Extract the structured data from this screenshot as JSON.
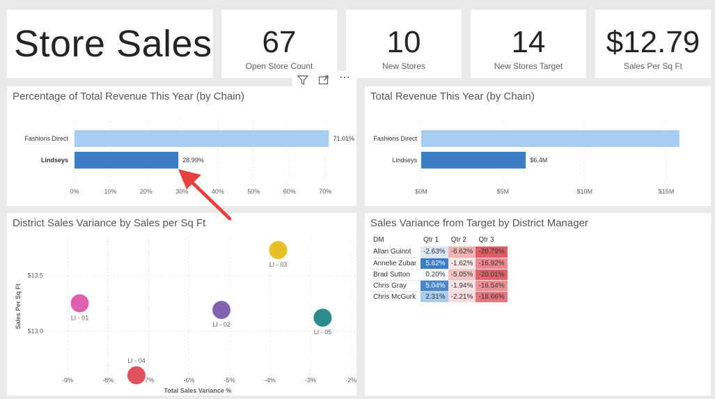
{
  "report": {
    "title": "Store Sales"
  },
  "cards": [
    {
      "value": "67",
      "label": "Open Store Count"
    },
    {
      "value": "10",
      "label": "New Stores"
    },
    {
      "value": "14",
      "label": "New Stores Target"
    },
    {
      "value": "$12.79",
      "label": "Sales Per Sq Ft"
    }
  ],
  "visual_header": {
    "filter_icon": "filter-icon",
    "focus_icon": "focus-mode-icon",
    "more_icon": "more-options-icon",
    "more_glyph": "⋯"
  },
  "colors": {
    "light_bar": "#a7cdf0",
    "dark_bar": "#3c7ec6",
    "arrow": "#e8423f"
  },
  "chart_data": [
    {
      "type": "bar",
      "title": "Percentage of Total Revenue This Year (by Chain)",
      "categories": [
        "Fashions Direct",
        "Lindseys"
      ],
      "values": [
        71.01,
        28.99
      ],
      "value_labels": [
        "71.01%",
        "28.99%"
      ],
      "xlim": [
        0,
        75
      ],
      "ticks": [
        0,
        10,
        20,
        30,
        40,
        50,
        60,
        70
      ],
      "tick_labels": [
        "0%",
        "10%",
        "20%",
        "30%",
        "40%",
        "50%",
        "60%",
        "70%"
      ]
    },
    {
      "type": "bar",
      "title": "Total Revenue This Year (by Chain)",
      "categories": [
        "Fashions Direct",
        "Lindseys"
      ],
      "values": [
        15.8,
        6.4
      ],
      "value_labels": [
        "",
        "$6.4M"
      ],
      "xlim": [
        0,
        17
      ],
      "ticks": [
        0,
        5,
        10,
        15
      ],
      "tick_labels": [
        "$0M",
        "$5M",
        "$10M",
        "$15M"
      ]
    },
    {
      "type": "scatter",
      "title": "District Sales Variance by Sales per Sq Ft",
      "xlabel": "Total Sales Variance %",
      "ylabel": "Sales Per Sq Ft",
      "xlim": [
        -9.5,
        -1.9
      ],
      "ylim": [
        12.6,
        13.85
      ],
      "xticks": [
        -9,
        -8,
        -7,
        -6,
        -5,
        -4,
        -3,
        -2
      ],
      "xtick_labels": [
        "-9%",
        "-8%",
        "-7%",
        "-6%",
        "-5%",
        "-4%",
        "-3%",
        "-2%"
      ],
      "yticks": [
        13.0,
        13.5
      ],
      "ytick_labels": [
        "$13.0",
        "$13.5"
      ],
      "points": [
        {
          "label": "LI - 01",
          "x": -8.7,
          "y": 13.25,
          "color": "#e05fae"
        },
        {
          "label": "LI - 02",
          "x": -5.2,
          "y": 13.19,
          "color": "#8064b2"
        },
        {
          "label": "LI - 03",
          "x": -3.8,
          "y": 13.73,
          "color": "#e5c126"
        },
        {
          "label": "LI - 04",
          "x": -7.3,
          "y": 12.6,
          "color": "#e0525c"
        },
        {
          "label": "LI - 05",
          "x": -2.7,
          "y": 13.12,
          "color": "#2d8c8c"
        }
      ]
    },
    {
      "type": "table",
      "title": "Sales Variance from Target by District Manager",
      "columns": [
        "DM",
        "Qtr 1",
        "Qtr 2",
        "Qtr 3"
      ],
      "rows": [
        {
          "dm": "Allan Guinot",
          "q1": "-2.63%",
          "q2": "-6.62%",
          "q3": "-20.79%"
        },
        {
          "dm": "Annelie Zubar",
          "q1": "5.62%",
          "q2": "-1.62%",
          "q3": "-16.92%"
        },
        {
          "dm": "Brad Sutton",
          "q1": "0.20%",
          "q2": "-5.05%",
          "q3": "-20.01%"
        },
        {
          "dm": "Chris Gray",
          "q1": "5.04%",
          "q2": "-1.94%",
          "q3": "-16.54%"
        },
        {
          "dm": "Chris McGurk",
          "q1": "2.31%",
          "q2": "-2.21%",
          "q3": "-18.66%"
        }
      ]
    }
  ]
}
